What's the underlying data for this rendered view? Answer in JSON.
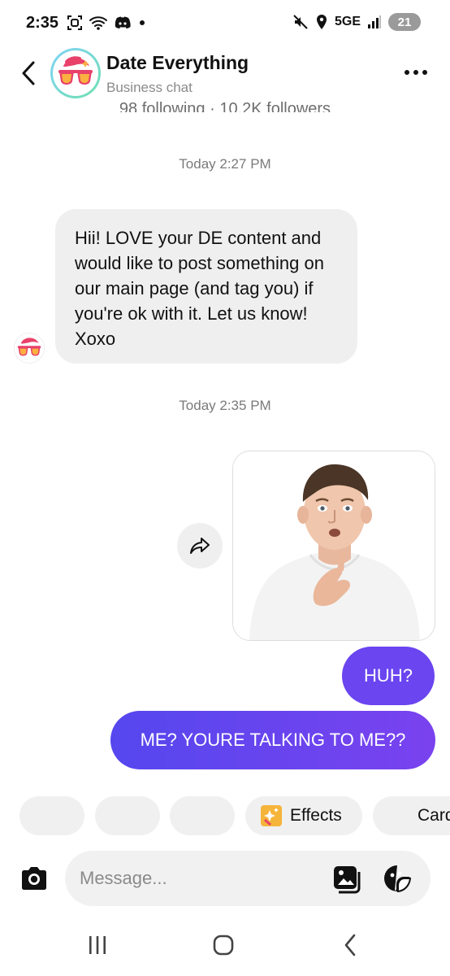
{
  "status_bar": {
    "time": "2:35",
    "network": "5GE",
    "battery": "21"
  },
  "header": {
    "title": "Date Everything",
    "subtitle": "Business chat",
    "avatar_icon": "sunglasses-logo-icon"
  },
  "profile": {
    "stats": "98 following · 10.2K followers"
  },
  "messages": {
    "timestamp_1": "Today 2:27 PM",
    "received_text": "Hii! LOVE your DE content and would like to post something on our main page (and tag you) if you're ok with it. Let us know!  Xoxo",
    "timestamp_2": "Today 2:35 PM",
    "sent_1": "HUH?",
    "sent_2": "ME? YOURE TALKING TO ME??"
  },
  "chips": {
    "effects_label": "Effects",
    "cards_label": "Cards"
  },
  "composer": {
    "placeholder": "Message..."
  },
  "colors": {
    "sent_bubble": "#6a45f0",
    "sent_bubble_gradient_end": "#7a42ef",
    "received_bubble": "#efefef"
  }
}
